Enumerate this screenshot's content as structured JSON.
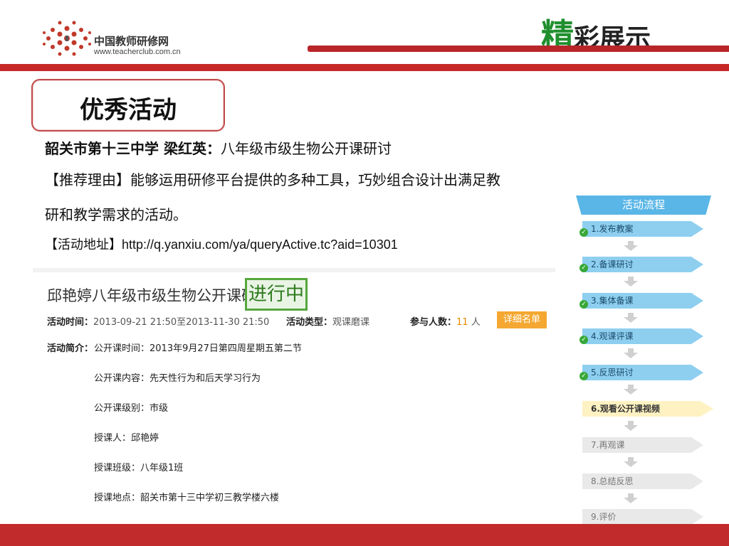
{
  "header": {
    "logo_cn": "中国教师研修网",
    "logo_en": "www.teacherclub.com.cn",
    "title_first": "精",
    "title_rest": "彩展示",
    "accent": "#c62828",
    "title_green": "#1f8f2d"
  },
  "badge": {
    "label": "优秀活动"
  },
  "content": {
    "school_teacher": "韶关市第十三中学  梁红英：",
    "topic": "八年级市级生物公开课研讨",
    "reason_line1": "【推荐理由】能够运用研修平台提供的多种工具，巧妙组合设计出满足教",
    "reason_line2": "研和教学需求的活动。",
    "address_label": "【活动地址】",
    "address_url": "http://q.yanxiu.com/ya/queryActive.tc?aid=10301"
  },
  "activity": {
    "title": "邱艳婷八年级市级生物公开课研讨",
    "status": "进行中",
    "time_label": "活动时间：",
    "time_value": "2013-09-21 21:50至2013-11-30 21:50",
    "type_label": "活动类型：",
    "type_value": "观课磨课",
    "people_label": "参与人数：",
    "people_count": "11",
    "people_unit": "人",
    "detail_button": "详细名单",
    "intro_label": "活动简介：",
    "intro_lines": [
      "公开课时间：2013年9月27日第四周星期五第二节",
      "公开课内容：先天性行为和后天学习行为",
      "公开课级别：市级",
      "授课人：邱艳婷",
      "授课班级：八年级1班",
      "授课地点：韶关市第十三中学初三教学楼六楼"
    ]
  },
  "flow": {
    "header": "活动流程",
    "steps": [
      {
        "label": "1.发布教案",
        "state": "done"
      },
      {
        "label": "2.备课研讨",
        "state": "done"
      },
      {
        "label": "3.集体备课",
        "state": "done"
      },
      {
        "label": "4.观课评课",
        "state": "done"
      },
      {
        "label": "5.反思研讨",
        "state": "done"
      },
      {
        "label": "6.观看公开课视频",
        "state": "active"
      },
      {
        "label": "7.再观课",
        "state": "todo"
      },
      {
        "label": "8.总结反思",
        "state": "todo"
      },
      {
        "label": "9.评价",
        "state": "todo"
      }
    ]
  }
}
